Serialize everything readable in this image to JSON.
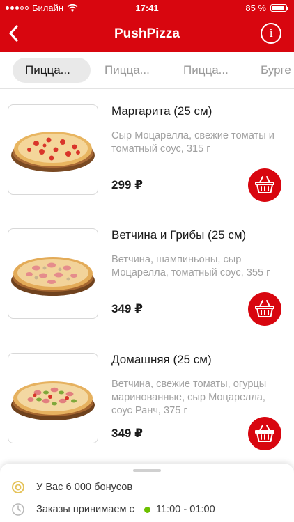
{
  "status_bar": {
    "carrier": "Билайн",
    "time": "17:41",
    "battery_text": "85 %",
    "battery_level": 0.85
  },
  "header": {
    "title": "PushPizza",
    "back_icon": "chevron-left-icon",
    "info_icon": "info-icon"
  },
  "tabs": [
    {
      "label": "Пицца..."
    },
    {
      "label": "Пицца..."
    },
    {
      "label": "Пицца..."
    },
    {
      "label": "Бурге"
    }
  ],
  "products": [
    {
      "name": "Маргарита (25 см)",
      "description": "Сыр Моцарелла, свежие томаты и томатный соус, 315 г",
      "price": "299 ₽"
    },
    {
      "name": "Ветчина и Грибы (25 см)",
      "description": "Ветчина, шампиньоны, сыр Моцарелла, томатный соус, 355 г",
      "price": "349 ₽"
    },
    {
      "name": "Домашняя (25 см)",
      "description": "Ветчина, свежие томаты, огурцы маринованные, сыр Моцарелла, соус Ранч, 375 г",
      "price": "349 ₽"
    }
  ],
  "bottom_sheet": {
    "bonus_text": "У Вас 6 000 бонусов",
    "hours_label": "Заказы принимаем с",
    "hours_value": "11:00 - 01:00"
  },
  "colors": {
    "brand_red": "#d8060f",
    "open_green": "#6cc000"
  }
}
